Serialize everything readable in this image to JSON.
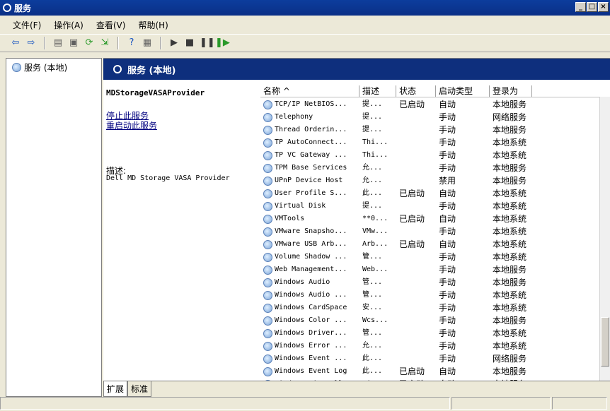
{
  "window": {
    "title": "服务",
    "controls": [
      "_",
      "□",
      "×"
    ]
  },
  "menu": [
    "文件(F)",
    "操作(A)",
    "查看(V)",
    "帮助(H)"
  ],
  "toolbar": [
    "back-icon",
    "forward-icon",
    "up-icon",
    "show-hide-tree-icon",
    "refresh-icon",
    "export-icon",
    "help-icon",
    "properties-icon",
    "play-icon",
    "stop-icon",
    "pause-icon",
    "resume-icon"
  ],
  "tree": {
    "root_label": "服务 (本地)"
  },
  "main": {
    "header": "服务 (本地)",
    "selected_service": "MDStorageVASAProvider",
    "links": {
      "stop": "停止此服务",
      "restart": "重启动此服务"
    },
    "description_label": "描述:",
    "description_text": "Dell MD Storage VASA Provider"
  },
  "columns": {
    "name": "名称",
    "desc": "描述",
    "status": "状态",
    "startup": "启动类型",
    "logon": "登录为"
  },
  "services": [
    {
      "name": "TCP/IP NetBIOS...",
      "desc": "提...",
      "status": "已启动",
      "startup": "自动",
      "logon": "本地服务"
    },
    {
      "name": "Telephony",
      "desc": "提...",
      "status": "",
      "startup": "手动",
      "logon": "网络服务"
    },
    {
      "name": "Thread Orderin...",
      "desc": "提...",
      "status": "",
      "startup": "手动",
      "logon": "本地服务"
    },
    {
      "name": "TP AutoConnect...",
      "desc": "Thi...",
      "status": "",
      "startup": "手动",
      "logon": "本地系统"
    },
    {
      "name": "TP VC Gateway ...",
      "desc": "Thi...",
      "status": "",
      "startup": "手动",
      "logon": "本地系统"
    },
    {
      "name": "TPM Base Services",
      "desc": "允...",
      "status": "",
      "startup": "手动",
      "logon": "本地服务"
    },
    {
      "name": "UPnP Device Host",
      "desc": "允...",
      "status": "",
      "startup": "禁用",
      "logon": "本地服务"
    },
    {
      "name": "User Profile S...",
      "desc": "此...",
      "status": "已启动",
      "startup": "自动",
      "logon": "本地系统"
    },
    {
      "name": "Virtual Disk",
      "desc": "提...",
      "status": "",
      "startup": "手动",
      "logon": "本地系统"
    },
    {
      "name": "VMTools",
      "desc": "**0...",
      "status": "已启动",
      "startup": "自动",
      "logon": "本地系统"
    },
    {
      "name": "VMware Snapsho...",
      "desc": "VMw...",
      "status": "",
      "startup": "手动",
      "logon": "本地系统"
    },
    {
      "name": "VMware USB Arb...",
      "desc": "Arb...",
      "status": "已启动",
      "startup": "自动",
      "logon": "本地系统"
    },
    {
      "name": "Volume Shadow ...",
      "desc": "管...",
      "status": "",
      "startup": "手动",
      "logon": "本地系统"
    },
    {
      "name": "Web Management...",
      "desc": "Web...",
      "status": "",
      "startup": "手动",
      "logon": "本地服务"
    },
    {
      "name": "Windows Audio",
      "desc": "管...",
      "status": "",
      "startup": "手动",
      "logon": "本地服务"
    },
    {
      "name": "Windows Audio ...",
      "desc": "管...",
      "status": "",
      "startup": "手动",
      "logon": "本地系统"
    },
    {
      "name": "Windows CardSpace",
      "desc": "安...",
      "status": "",
      "startup": "手动",
      "logon": "本地系统"
    },
    {
      "name": "Windows Color ...",
      "desc": "Wcs...",
      "status": "",
      "startup": "手动",
      "logon": "本地服务"
    },
    {
      "name": "Windows Driver...",
      "desc": "管...",
      "status": "",
      "startup": "手动",
      "logon": "本地系统"
    },
    {
      "name": "Windows Error ...",
      "desc": "允...",
      "status": "",
      "startup": "手动",
      "logon": "本地系统"
    },
    {
      "name": "Windows Event ...",
      "desc": "此...",
      "status": "",
      "startup": "手动",
      "logon": "网络服务"
    },
    {
      "name": "Windows Event Log",
      "desc": "此...",
      "status": "已启动",
      "startup": "自动",
      "logon": "本地服务"
    },
    {
      "name": "Windows Firewall",
      "desc": "Win...",
      "status": "已启动",
      "startup": "自动",
      "logon": "本地服务"
    }
  ],
  "tabs": [
    "扩展",
    "标准"
  ]
}
